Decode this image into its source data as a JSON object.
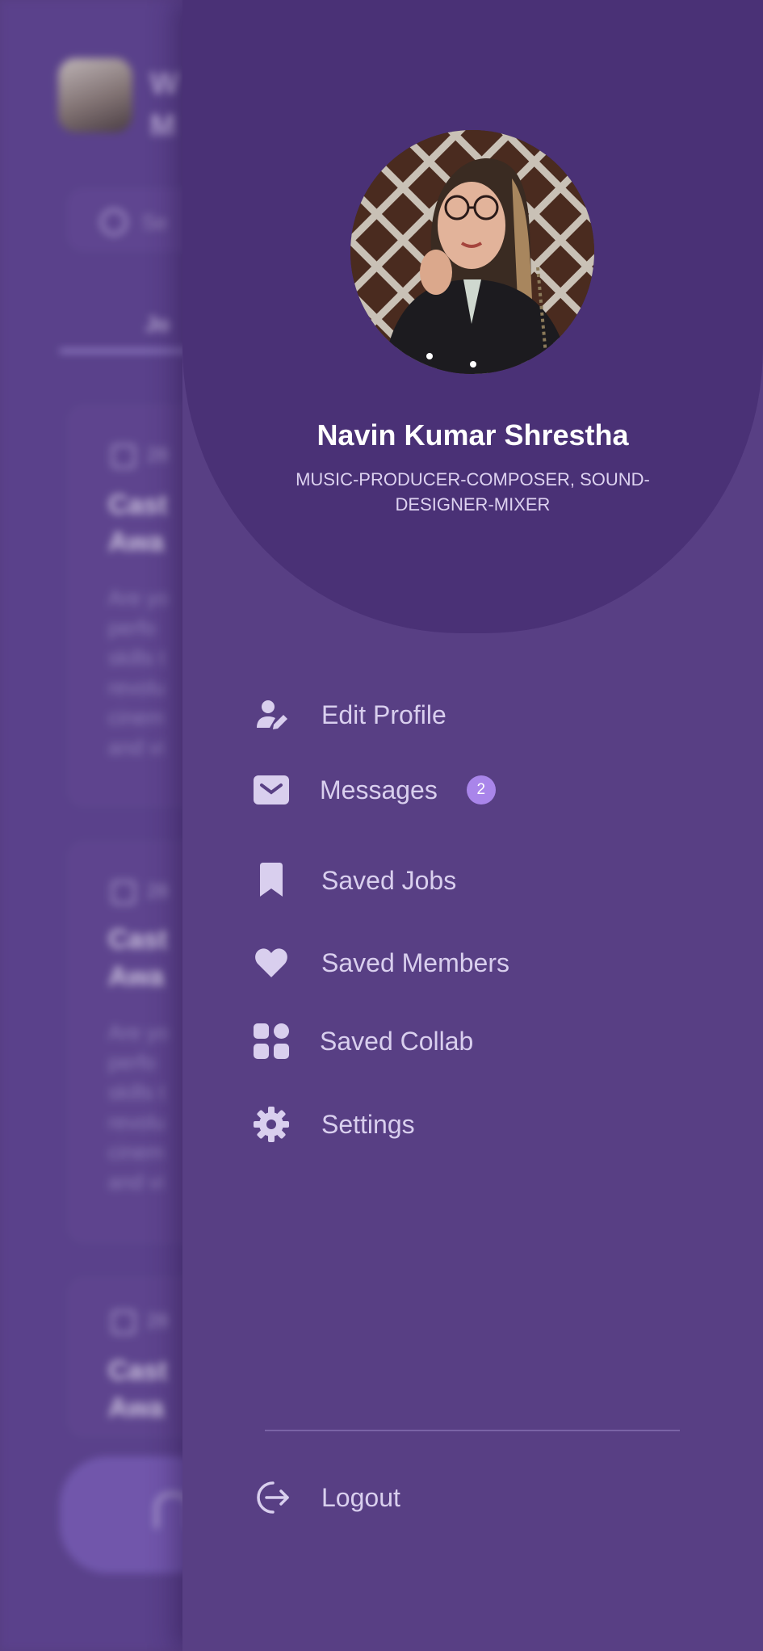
{
  "background_screen": {
    "greeting_lines": [
      "W",
      "M"
    ],
    "search_placeholder": "Se",
    "active_tab": "Jo",
    "cards": [
      {
        "date": "28",
        "title_lines": [
          "Cast",
          "Awa"
        ],
        "body_lines": [
          "Are yo",
          "perfo",
          "skills t",
          "revolu",
          "cinem",
          "and vi"
        ]
      },
      {
        "date": "28",
        "title_lines": [
          "Cast",
          "Awa"
        ],
        "body_lines": [
          "Are yo",
          "perfo",
          "skills t",
          "revolu",
          "cinem",
          "and vi"
        ]
      },
      {
        "date": "28",
        "title_lines": [
          "Cast",
          "Awa"
        ],
        "body_lines": []
      }
    ]
  },
  "drawer": {
    "profile": {
      "name": "Navin Kumar Shrestha",
      "role": "MUSIC-PRODUCER-COMPOSER, SOUND-DESIGNER-MIXER"
    },
    "menu": [
      {
        "label": "Edit Profile",
        "icon": "user-edit-icon"
      },
      {
        "label": "Messages",
        "icon": "envelope-icon",
        "badge": "2"
      },
      {
        "label": "Saved Jobs",
        "icon": "bookmark-icon"
      },
      {
        "label": "Saved Members",
        "icon": "heart-icon"
      },
      {
        "label": "Saved Collab",
        "icon": "grid-icon"
      },
      {
        "label": "Settings",
        "icon": "gear-icon"
      }
    ],
    "logout": {
      "label": "Logout",
      "icon": "logout-icon"
    }
  },
  "colors": {
    "drawer_bg": "#583f84",
    "header_bg": "#4a3176",
    "badge_bg": "#a985ea",
    "menu_text": "#d9cfee"
  }
}
